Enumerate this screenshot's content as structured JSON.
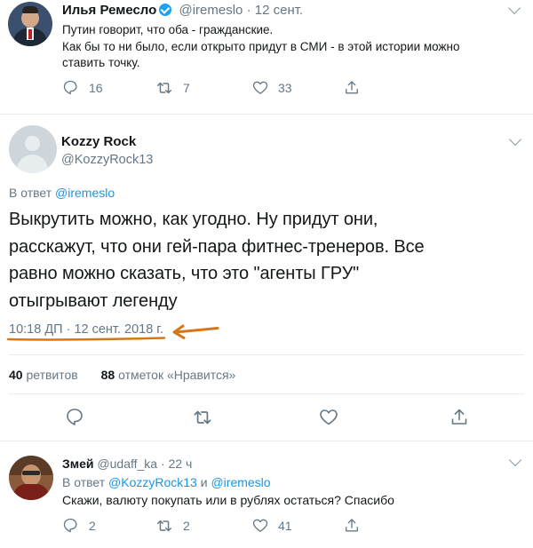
{
  "tweet1": {
    "name": "Илья Ремесло",
    "handle": "@iremeslo",
    "dot": "·",
    "date": "12 сент.",
    "text_line1": "Путин говорит, что оба - гражданские.",
    "text_line2": "Как бы то ни было, если открыто придут в СМИ - в этой истории можно",
    "text_line3": "ставить точку.",
    "replies": "16",
    "retweets": "7",
    "likes": "33"
  },
  "main_tweet": {
    "name": "Kozzy Rock",
    "handle": "@KozzyRock13",
    "reply_prefix": "В ответ",
    "reply_to": "@iremeslo",
    "text_line1": "Выкрутить можно, как угодно. Ну придут они,",
    "text_line2": "расскажут, что они гей-пара фитнес-тренеров. Все",
    "text_line3": "равно можно сказать, что это \"агенты ГРУ\"",
    "text_line4": "отыгрывают легенду",
    "timestamp": "10:18 ДП · 12 сент. 2018 г.",
    "retweets_count": "40",
    "retweets_label": "ретвитов",
    "likes_count": "88",
    "likes_label": "отметок «Нравится»"
  },
  "tweet3": {
    "name": "Змей",
    "handle": "@udaff_ka",
    "dot": "·",
    "date": "22 ч",
    "reply_prefix": "В ответ",
    "reply_to_1": "@KozzyRock13",
    "reply_and": "и",
    "reply_to_2": "@iremeslo",
    "text": "Скажи, валюту покупать или в рублях остаться? Спасибо",
    "replies": "2",
    "retweets": "2",
    "likes": "41"
  },
  "annotation": {
    "color": "#d4771a"
  },
  "icons": [
    "reply-icon",
    "retweet-icon",
    "like-icon",
    "share-icon",
    "chevron-down-icon",
    "verified-badge-icon"
  ]
}
